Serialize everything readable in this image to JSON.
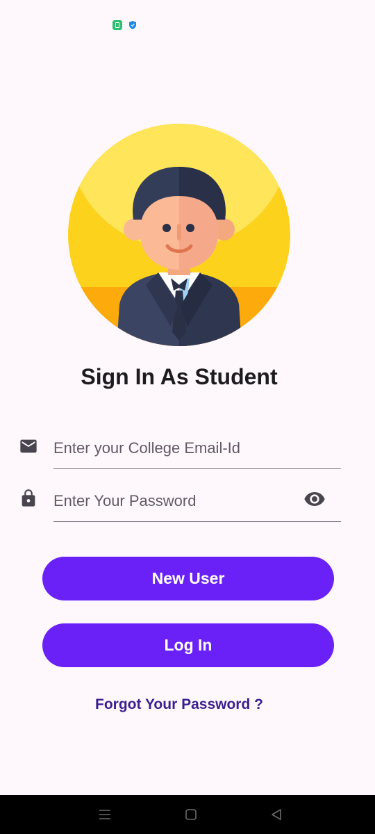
{
  "page": {
    "title": "Sign In As Student"
  },
  "form": {
    "email_placeholder": "Enter your College Email-Id",
    "password_placeholder": "Enter Your Password",
    "new_user_label": "New User",
    "login_label": "Log In",
    "forgot_label": "Forgot Your Password ?"
  },
  "icons": {
    "email": "mail-icon",
    "password": "lock-icon",
    "visibility": "eye-icon",
    "avatar": "student-avatar"
  },
  "colors": {
    "primary": "#6a21f8",
    "link": "#3b1f8c",
    "background": "#fef8fd"
  }
}
